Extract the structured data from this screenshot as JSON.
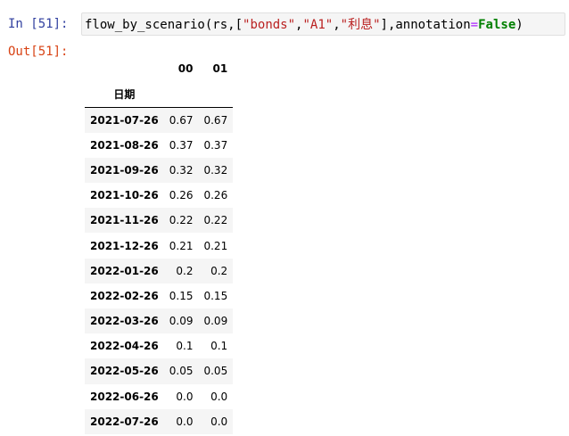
{
  "input_cell": {
    "prompt": "In [51]:",
    "code": {
      "func": "flow_by_scenario",
      "open_paren": "(",
      "arg_rs": "rs,",
      "open_list": "[",
      "str1": "\"bonds\"",
      "comma1": ",",
      "str2": "\"A1\"",
      "comma2": ",",
      "str3": "\"利息\"",
      "close_list": "]",
      "comma3": ",",
      "kwarg": "annotation",
      "eq": "=",
      "kw_false": "False",
      "close_paren": ")"
    }
  },
  "output_cell": {
    "prompt": "Out[51]:",
    "table": {
      "columns": [
        "00",
        "01"
      ],
      "index_name": "日期",
      "rows": [
        {
          "date": "2021-07-26",
          "v00": "0.67",
          "v01": "0.67"
        },
        {
          "date": "2021-08-26",
          "v00": "0.37",
          "v01": "0.37"
        },
        {
          "date": "2021-09-26",
          "v00": "0.32",
          "v01": "0.32"
        },
        {
          "date": "2021-10-26",
          "v00": "0.26",
          "v01": "0.26"
        },
        {
          "date": "2021-11-26",
          "v00": "0.22",
          "v01": "0.22"
        },
        {
          "date": "2021-12-26",
          "v00": "0.21",
          "v01": "0.21"
        },
        {
          "date": "2022-01-26",
          "v00": "0.2",
          "v01": "0.2"
        },
        {
          "date": "2022-02-26",
          "v00": "0.15",
          "v01": "0.15"
        },
        {
          "date": "2022-03-26",
          "v00": "0.09",
          "v01": "0.09"
        },
        {
          "date": "2022-04-26",
          "v00": "0.1",
          "v01": "0.1"
        },
        {
          "date": "2022-05-26",
          "v00": "0.05",
          "v01": "0.05"
        },
        {
          "date": "2022-06-26",
          "v00": "0.0",
          "v01": "0.0"
        },
        {
          "date": "2022-07-26",
          "v00": "0.0",
          "v01": "0.0"
        }
      ]
    }
  }
}
